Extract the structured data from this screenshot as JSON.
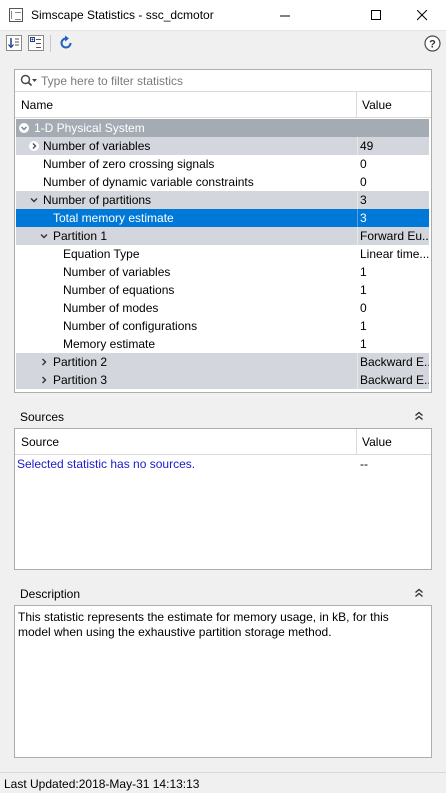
{
  "window": {
    "title": "Simscape Statistics - ssc_dcmotor",
    "minimize": "—",
    "maximize": "☐",
    "close": "✕"
  },
  "toolbar": {
    "icons": [
      "sort-icon",
      "expand-collapse-icon",
      "refresh-icon",
      "help-icon"
    ],
    "help_label": "?"
  },
  "filter": {
    "placeholder": "Type here to filter statistics"
  },
  "stats_table": {
    "columns": [
      "Name",
      "Value"
    ],
    "rows": [
      {
        "name": "1-D Physical System",
        "value": ""
      },
      {
        "name": "Number of variables",
        "value": "49"
      },
      {
        "name": "Number of zero crossing signals",
        "value": "0"
      },
      {
        "name": "Number of dynamic variable constraints",
        "value": "0"
      },
      {
        "name": "Number of partitions",
        "value": "3"
      },
      {
        "name": "Total memory estimate",
        "value": "3"
      },
      {
        "name": "Partition 1",
        "value": "Forward Eu..."
      },
      {
        "name": "Equation Type",
        "value": "Linear time..."
      },
      {
        "name": "Number of variables",
        "value": "1"
      },
      {
        "name": "Number of equations",
        "value": "1"
      },
      {
        "name": "Number of modes",
        "value": "0"
      },
      {
        "name": "Number of configurations",
        "value": "1"
      },
      {
        "name": "Memory estimate",
        "value": "1"
      },
      {
        "name": "Partition 2",
        "value": "Backward E..."
      },
      {
        "name": "Partition 3",
        "value": "Backward E..."
      }
    ]
  },
  "sources": {
    "title": "Sources",
    "columns": [
      "Source",
      "Value"
    ],
    "rows": [
      {
        "source": "Selected statistic has no sources.",
        "value": "--"
      }
    ]
  },
  "description": {
    "title": "Description",
    "text": "This statistic represents the estimate for memory usage, in kB, for this model when using the exhaustive partition storage method."
  },
  "status": {
    "text": "Last Updated:2018-May-31 14:13:13"
  },
  "colors": {
    "selection": "#0078d7",
    "system_row": "#a5abb3",
    "group_row": "#d3d6dc",
    "link": "#1a1ac8"
  }
}
